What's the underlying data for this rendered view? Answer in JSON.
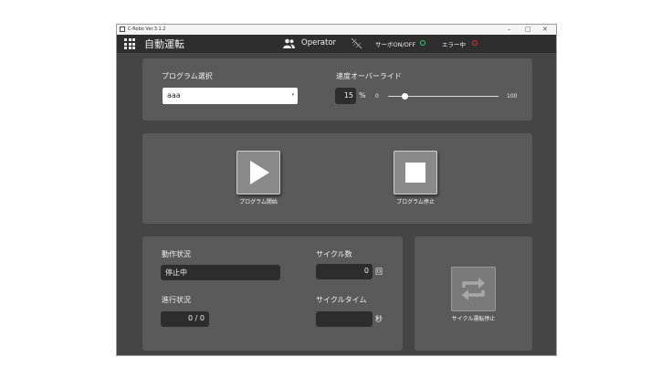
{
  "window": {
    "title": "C-Robo Ver.3.1.2"
  },
  "header": {
    "title": "自動運転",
    "user_label": "Operator",
    "servo_label": "サーボON/OFF",
    "error_label": "エラー中",
    "servo_color": "#2ecc71",
    "error_color": "#e03030"
  },
  "program": {
    "label": "プログラム選択",
    "selected": "aaa"
  },
  "speed": {
    "label": "速度オーバーライド",
    "value": "15",
    "unit": "%",
    "min_label": "0",
    "max_label": "100",
    "level_percent": 15
  },
  "controls": {
    "start_label": "プログラム開始",
    "stop_label": "プログラム停止"
  },
  "status": {
    "operation_label": "動作状況",
    "operation_value": "停止中",
    "progress_label": "進行状況",
    "progress_value": "0 / 0",
    "cycle_count_label": "サイクル数",
    "cycle_count_value": "0",
    "cycle_count_unit": "回",
    "cycle_time_label": "サイクルタイム",
    "cycle_time_value": "",
    "cycle_time_unit": "秒"
  },
  "cycle": {
    "stop_label": "サイクル運転停止"
  }
}
